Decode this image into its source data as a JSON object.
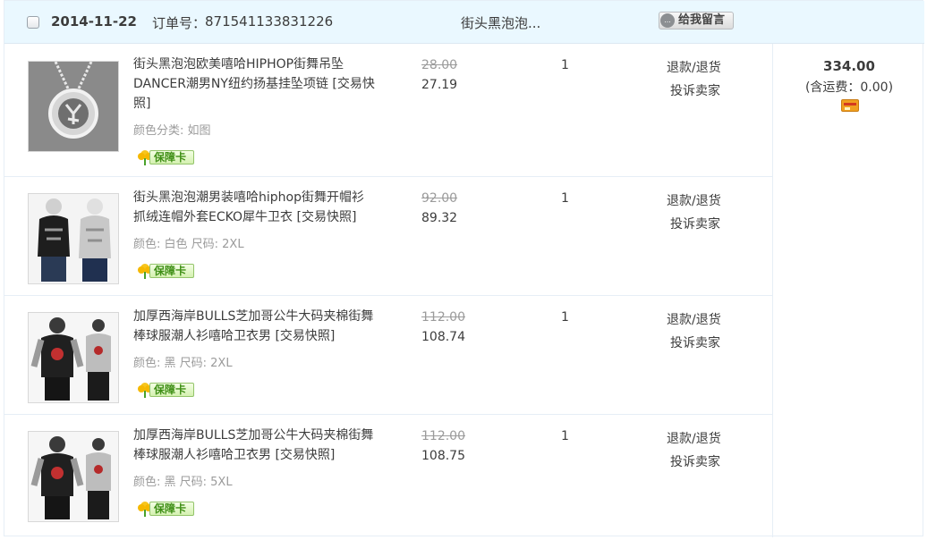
{
  "order": {
    "date": "2014-11-22",
    "order_no_label": "订单号：",
    "order_no": "871541133831226",
    "shop_name": "街头黑泡泡...",
    "message_button": "给我留言",
    "message_icon_text": "...",
    "total": "334.00",
    "shipping": "(含运费：0.00)",
    "icons": {
      "checkbox": "checkbox",
      "message": "speech-bubble-icon",
      "payment": "alipay-card-icon",
      "guarantee": "guarantee-flower-icon"
    }
  },
  "items": [
    {
      "title": "街头黑泡泡欧美嘻哈HIPHOP街舞吊坠DANCER潮男NY纽约扬基挂坠项链 [交易快照]",
      "sku": "颜色分类: 如图",
      "badge": "保障卡",
      "price_old": "28.00",
      "price_new": "27.19",
      "qty": "1",
      "refund": "退款/退货",
      "complain": "投诉卖家"
    },
    {
      "title": "街头黑泡泡潮男装嘻哈hiphop街舞开帽衫抓绒连帽外套ECKO犀牛卫衣 [交易快照]",
      "sku": "颜色: 白色  尺码: 2XL",
      "badge": "保障卡",
      "price_old": "92.00",
      "price_new": "89.32",
      "qty": "1",
      "refund": "退款/退货",
      "complain": "投诉卖家"
    },
    {
      "title": "加厚西海岸BULLS芝加哥公牛大码夹棉街舞棒球服潮人衫嘻哈卫衣男 [交易快照]",
      "sku": "颜色: 黑  尺码: 2XL",
      "badge": "保障卡",
      "price_old": "112.00",
      "price_new": "108.74",
      "qty": "1",
      "refund": "退款/退货",
      "complain": "投诉卖家"
    },
    {
      "title": "加厚西海岸BULLS芝加哥公牛大码夹棉街舞棒球服潮人衫嘻哈卫衣男 [交易快照]",
      "sku": "颜色: 黑  尺码: 5XL",
      "badge": "保障卡",
      "price_old": "112.00",
      "price_new": "108.75",
      "qty": "1",
      "refund": "退款/退货",
      "complain": "投诉卖家"
    }
  ]
}
